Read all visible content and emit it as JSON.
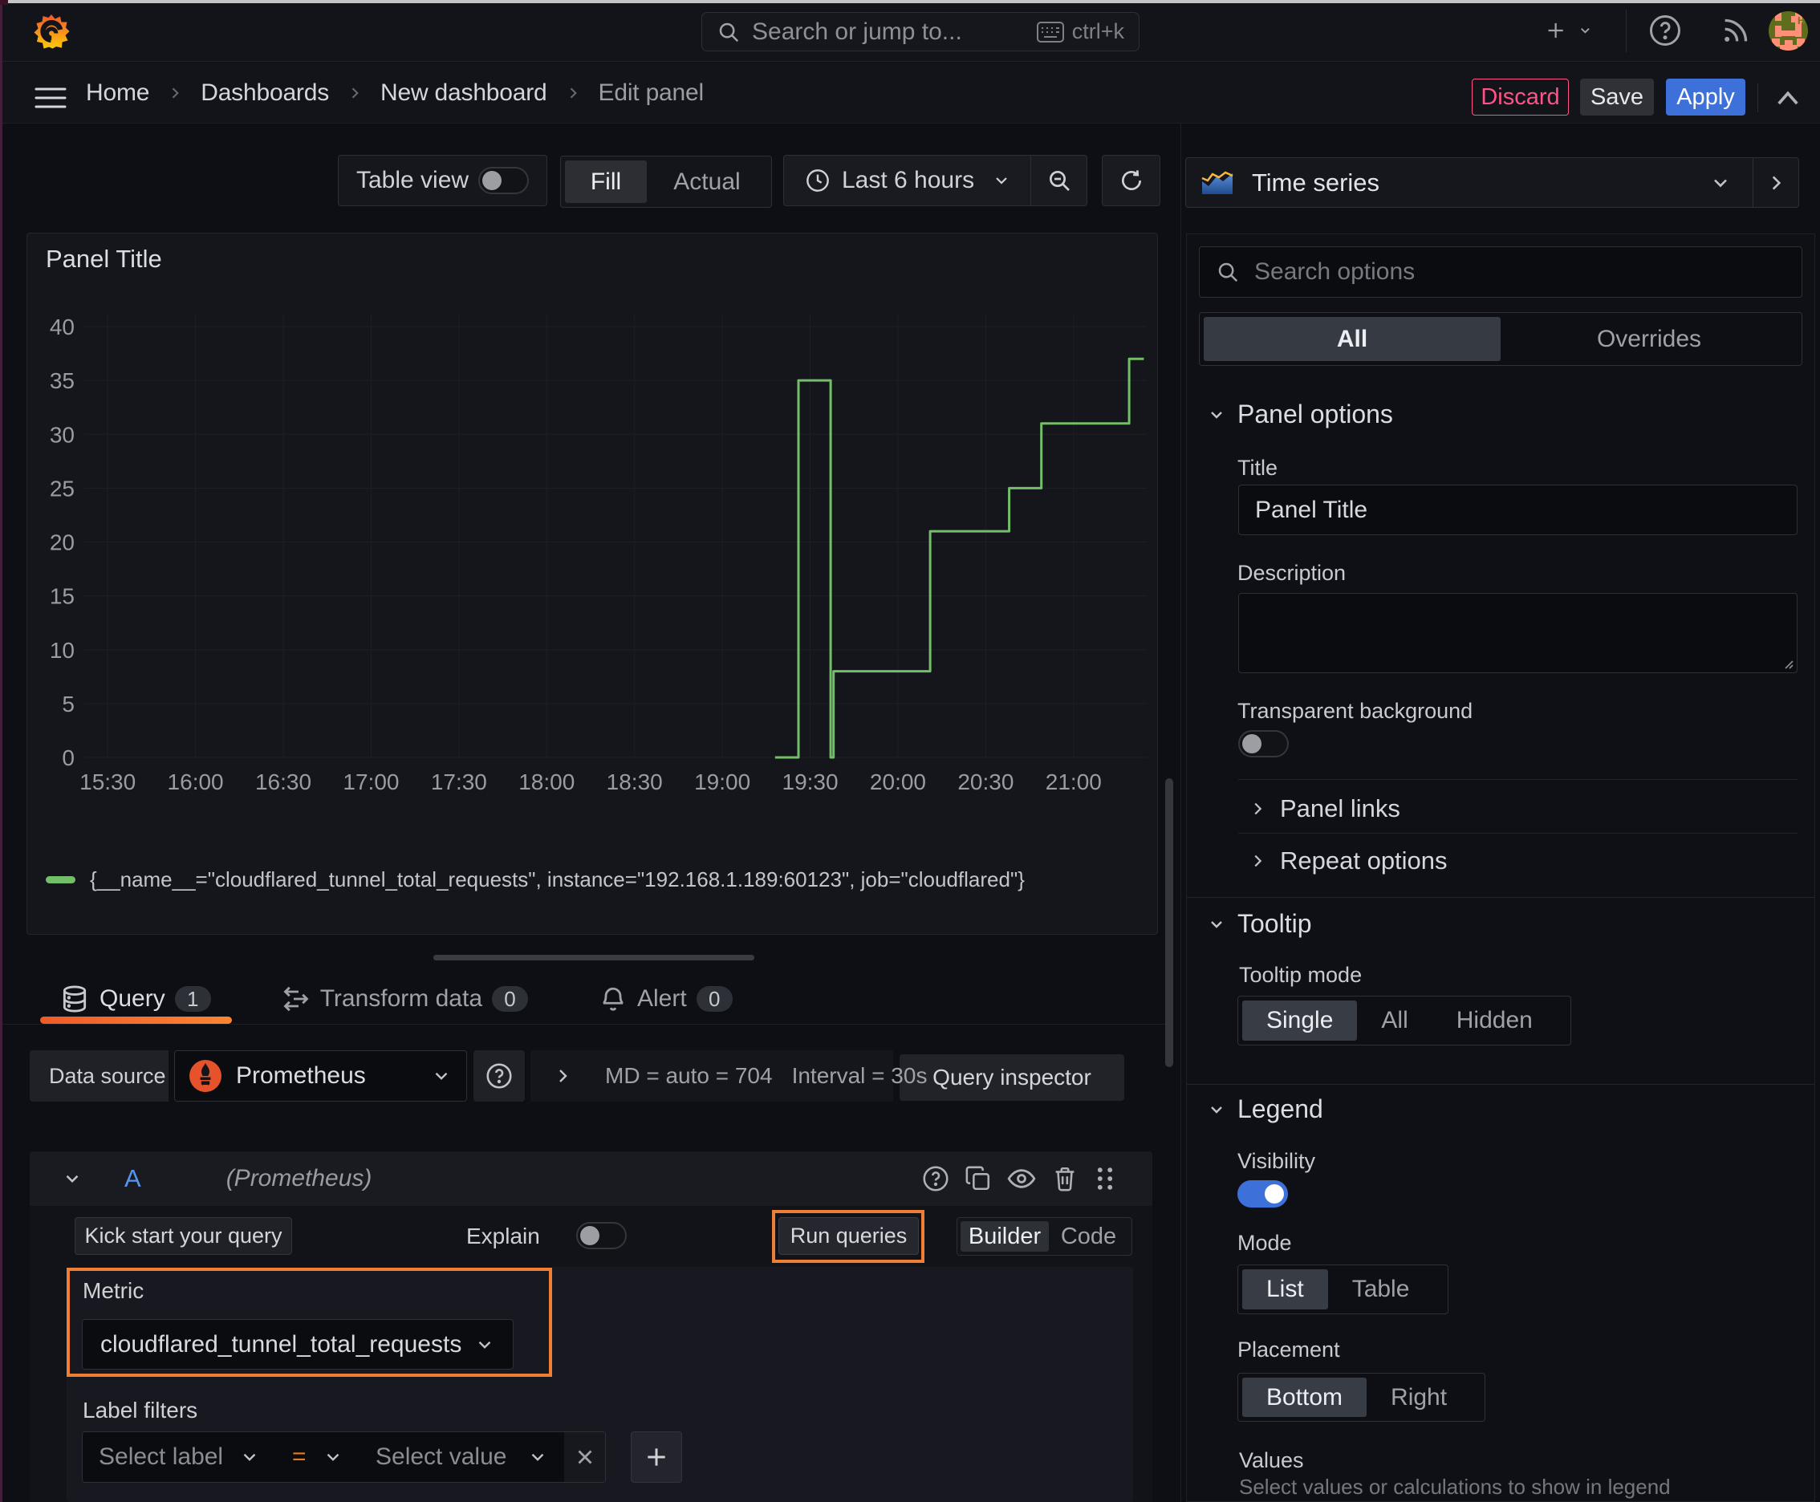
{
  "colors": {
    "accent_blue": "#3d71d9",
    "destructive_pink": "#ff5286",
    "annotation_orange": "#ee7f37",
    "tab_underline_gradient": [
      "#f05a28",
      "#fb8532"
    ],
    "series_green": "#73bf69",
    "prometheus_orange": "#e6522c"
  },
  "topbar": {
    "search_placeholder": "Search or jump to...",
    "search_shortcut": "ctrl+k"
  },
  "breadcrumbs": {
    "items": [
      "Home",
      "Dashboards",
      "New dashboard",
      "Edit panel"
    ]
  },
  "header_actions": {
    "discard": "Discard",
    "save": "Save",
    "apply": "Apply"
  },
  "toolbar": {
    "table_view_label": "Table view",
    "fill_label": "Fill",
    "actual_label": "Actual",
    "time_range_label": "Last 6 hours"
  },
  "panel": {
    "title": "Panel Title"
  },
  "chart_data": {
    "type": "line",
    "line_style": "step-after",
    "title": "Panel Title",
    "xlabel": "",
    "ylabel": "",
    "grid": true,
    "legend_position": "bottom",
    "x_ticks": [
      "15:30",
      "16:00",
      "16:30",
      "17:00",
      "17:30",
      "18:00",
      "18:30",
      "19:00",
      "19:30",
      "20:00",
      "20:30",
      "21:00"
    ],
    "x_start": "15:22",
    "x_end": "21:25",
    "y_ticks": [
      0,
      5,
      10,
      15,
      20,
      25,
      30,
      35,
      40
    ],
    "ylim": [
      0,
      40
    ],
    "series": [
      {
        "name": "{__name__=\"cloudflared_tunnel_total_requests\", instance=\"192.168.1.189:60123\", job=\"cloudflared\"}",
        "color": "#73bf69",
        "points": [
          [
            "19:18",
            0
          ],
          [
            "19:26",
            0
          ],
          [
            "19:26",
            35
          ],
          [
            "19:37",
            35
          ],
          [
            "19:37",
            0
          ],
          [
            "19:38",
            0
          ],
          [
            "19:38",
            8
          ],
          [
            "20:11",
            8
          ],
          [
            "20:11",
            21
          ],
          [
            "20:38",
            21
          ],
          [
            "20:38",
            25
          ],
          [
            "20:49",
            25
          ],
          [
            "20:49",
            31
          ],
          [
            "21:19",
            31
          ],
          [
            "21:19",
            37
          ],
          [
            "21:24",
            37
          ]
        ]
      }
    ]
  },
  "tabs": {
    "query": {
      "label": "Query",
      "badge": "1"
    },
    "transform": {
      "label": "Transform data",
      "badge": "0"
    },
    "alert": {
      "label": "Alert",
      "badge": "0"
    }
  },
  "datasource_row": {
    "label": "Data source",
    "value": "Prometheus",
    "max_data_points": "MD = auto = 704",
    "interval": "Interval = 30s",
    "query_inspector": "Query inspector"
  },
  "query_editor": {
    "ref_id": "A",
    "datasource_name": "(Prometheus)",
    "kick_start": "Kick start your query",
    "explain_label": "Explain",
    "run_queries": "Run queries",
    "builder_label": "Builder",
    "code_label": "Code",
    "metric_label": "Metric",
    "metric_value": "cloudflared_tunnel_total_requests",
    "label_filters_label": "Label filters",
    "select_label_placeholder": "Select label",
    "operator": "=",
    "select_value_placeholder": "Select value"
  },
  "options_pane": {
    "visualization": "Time series",
    "search_placeholder": "Search options",
    "tab_all": "All",
    "tab_overrides": "Overrides",
    "panel_options": {
      "header": "Panel options",
      "title_label": "Title",
      "title_value": "Panel Title",
      "description_label": "Description",
      "description_value": "",
      "transparent_label": "Transparent background",
      "panel_links": "Panel links",
      "repeat_options": "Repeat options"
    },
    "tooltip": {
      "header": "Tooltip",
      "mode_label": "Tooltip mode",
      "options": [
        "Single",
        "All",
        "Hidden"
      ],
      "selected": "Single"
    },
    "legend": {
      "header": "Legend",
      "visibility_label": "Visibility",
      "mode_label": "Mode",
      "mode_options": [
        "List",
        "Table"
      ],
      "mode_selected": "List",
      "placement_label": "Placement",
      "placement_options": [
        "Bottom",
        "Right"
      ],
      "placement_selected": "Bottom",
      "values_label": "Values",
      "values_hint": "Select values or calculations to show in legend"
    }
  }
}
